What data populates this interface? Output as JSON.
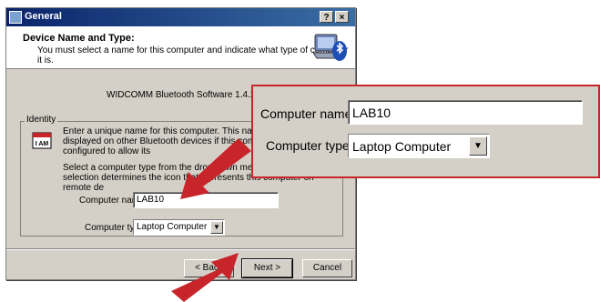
{
  "window": {
    "title": "General",
    "help_glyph": "?",
    "close_glyph": "×"
  },
  "header": {
    "title": "Device Name and Type:",
    "subtitle": "You must select a name for this computer and indicate what type of computer it is.",
    "icon": "bluetooth-laptop-icon"
  },
  "product": "WIDCOMM Bluetooth Software 1.4.2 Build 1",
  "identity": {
    "legend": "Identity",
    "paragraph1": "Enter a unique name for this computer.  This name will be displayed on other Bluetooth devices if this computer is configured to allow its",
    "paragraph2": "Select a computer type from the drop-down menu. This selection determines the icon that represents this computer on remote de",
    "computer_name_label": "Computer name:",
    "computer_name_value": "LAB10",
    "computer_type_label": "Computer type:",
    "computer_type_value": "Laptop Computer",
    "name_icon_text": "I AM"
  },
  "buttons": {
    "back": "< Back",
    "next": "Next >",
    "cancel": "Cancel"
  },
  "zoom": {
    "computer_name_label": "Computer name:",
    "computer_name_value": "LAB10",
    "computer_type_label": "Computer type:",
    "computer_type_value": "Laptop Computer"
  },
  "colors": {
    "callout_red": "#c8252b",
    "titlebar": "#0a246a",
    "dialog_face": "#d4d0c8"
  }
}
